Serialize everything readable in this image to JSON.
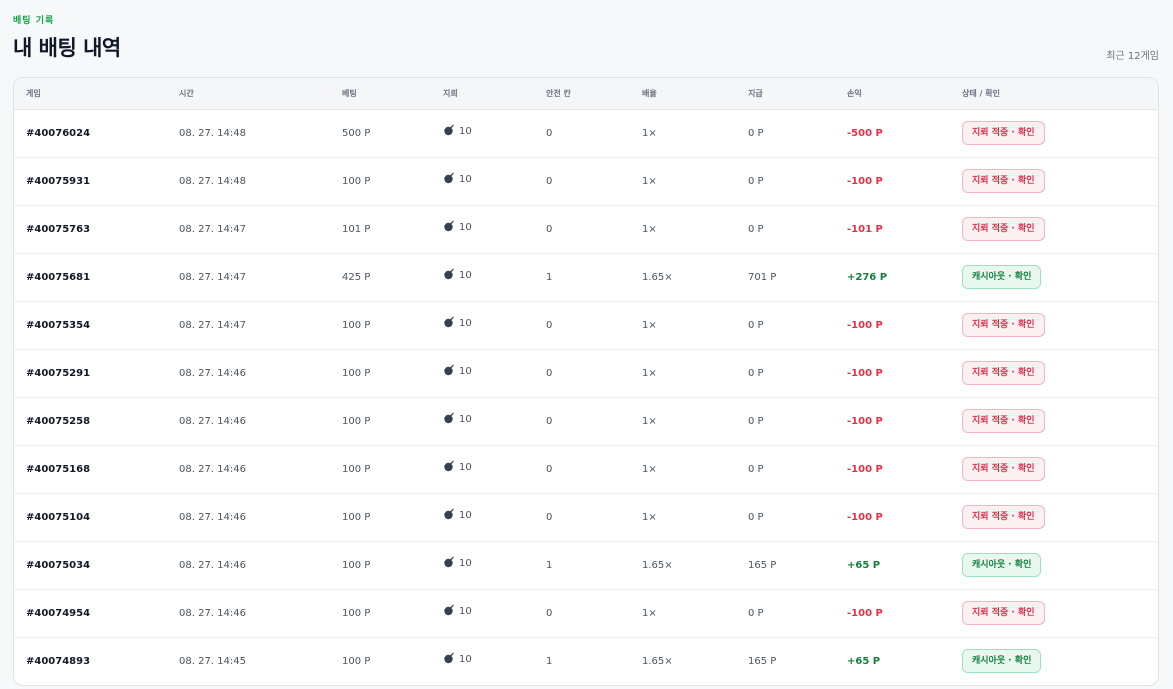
{
  "header": {
    "eyebrow": "배팅 기록",
    "title": "내 배팅 내역",
    "meta": "최근 12게임"
  },
  "table": {
    "columns": {
      "game": "게임",
      "time": "시간",
      "bet": "베팅",
      "mines": "지뢰",
      "safe": "안전 칸",
      "mult": "배율",
      "payout": "지급",
      "pnl": "손익",
      "status": "상태 / 확인"
    },
    "colors": {
      "loss": "#e0324a",
      "win": "#15803d",
      "mine_icon": "#374151"
    },
    "mine_icon": "bomb-icon",
    "rows": [
      {
        "game": "#40076024",
        "time": "08. 27. 14:48",
        "bet": "500 P",
        "mines": "10",
        "safe": "0",
        "mult": "1×",
        "payout": "0 P",
        "pnl": "-500 P",
        "status": "지뢰 적중 · 확인",
        "result": "loss"
      },
      {
        "game": "#40075931",
        "time": "08. 27. 14:48",
        "bet": "100 P",
        "mines": "10",
        "safe": "0",
        "mult": "1×",
        "payout": "0 P",
        "pnl": "-100 P",
        "status": "지뢰 적중 · 확인",
        "result": "loss"
      },
      {
        "game": "#40075763",
        "time": "08. 27. 14:47",
        "bet": "101 P",
        "mines": "10",
        "safe": "0",
        "mult": "1×",
        "payout": "0 P",
        "pnl": "-101 P",
        "status": "지뢰 적중 · 확인",
        "result": "loss"
      },
      {
        "game": "#40075681",
        "time": "08. 27. 14:47",
        "bet": "425 P",
        "mines": "10",
        "safe": "1",
        "mult": "1.65×",
        "payout": "701 P",
        "pnl": "+276 P",
        "status": "캐시아웃 · 확인",
        "result": "win"
      },
      {
        "game": "#40075354",
        "time": "08. 27. 14:47",
        "bet": "100 P",
        "mines": "10",
        "safe": "0",
        "mult": "1×",
        "payout": "0 P",
        "pnl": "-100 P",
        "status": "지뢰 적중 · 확인",
        "result": "loss"
      },
      {
        "game": "#40075291",
        "time": "08. 27. 14:46",
        "bet": "100 P",
        "mines": "10",
        "safe": "0",
        "mult": "1×",
        "payout": "0 P",
        "pnl": "-100 P",
        "status": "지뢰 적중 · 확인",
        "result": "loss"
      },
      {
        "game": "#40075258",
        "time": "08. 27. 14:46",
        "bet": "100 P",
        "mines": "10",
        "safe": "0",
        "mult": "1×",
        "payout": "0 P",
        "pnl": "-100 P",
        "status": "지뢰 적중 · 확인",
        "result": "loss"
      },
      {
        "game": "#40075168",
        "time": "08. 27. 14:46",
        "bet": "100 P",
        "mines": "10",
        "safe": "0",
        "mult": "1×",
        "payout": "0 P",
        "pnl": "-100 P",
        "status": "지뢰 적중 · 확인",
        "result": "loss"
      },
      {
        "game": "#40075104",
        "time": "08. 27. 14:46",
        "bet": "100 P",
        "mines": "10",
        "safe": "0",
        "mult": "1×",
        "payout": "0 P",
        "pnl": "-100 P",
        "status": "지뢰 적중 · 확인",
        "result": "loss"
      },
      {
        "game": "#40075034",
        "time": "08. 27. 14:46",
        "bet": "100 P",
        "mines": "10",
        "safe": "1",
        "mult": "1.65×",
        "payout": "165 P",
        "pnl": "+65 P",
        "status": "캐시아웃 · 확인",
        "result": "win"
      },
      {
        "game": "#40074954",
        "time": "08. 27. 14:46",
        "bet": "100 P",
        "mines": "10",
        "safe": "0",
        "mult": "1×",
        "payout": "0 P",
        "pnl": "-100 P",
        "status": "지뢰 적중 · 확인",
        "result": "loss"
      },
      {
        "game": "#40074893",
        "time": "08. 27. 14:45",
        "bet": "100 P",
        "mines": "10",
        "safe": "1",
        "mult": "1.65×",
        "payout": "165 P",
        "pnl": "+65 P",
        "status": "캐시아웃 · 확인",
        "result": "win"
      }
    ]
  }
}
